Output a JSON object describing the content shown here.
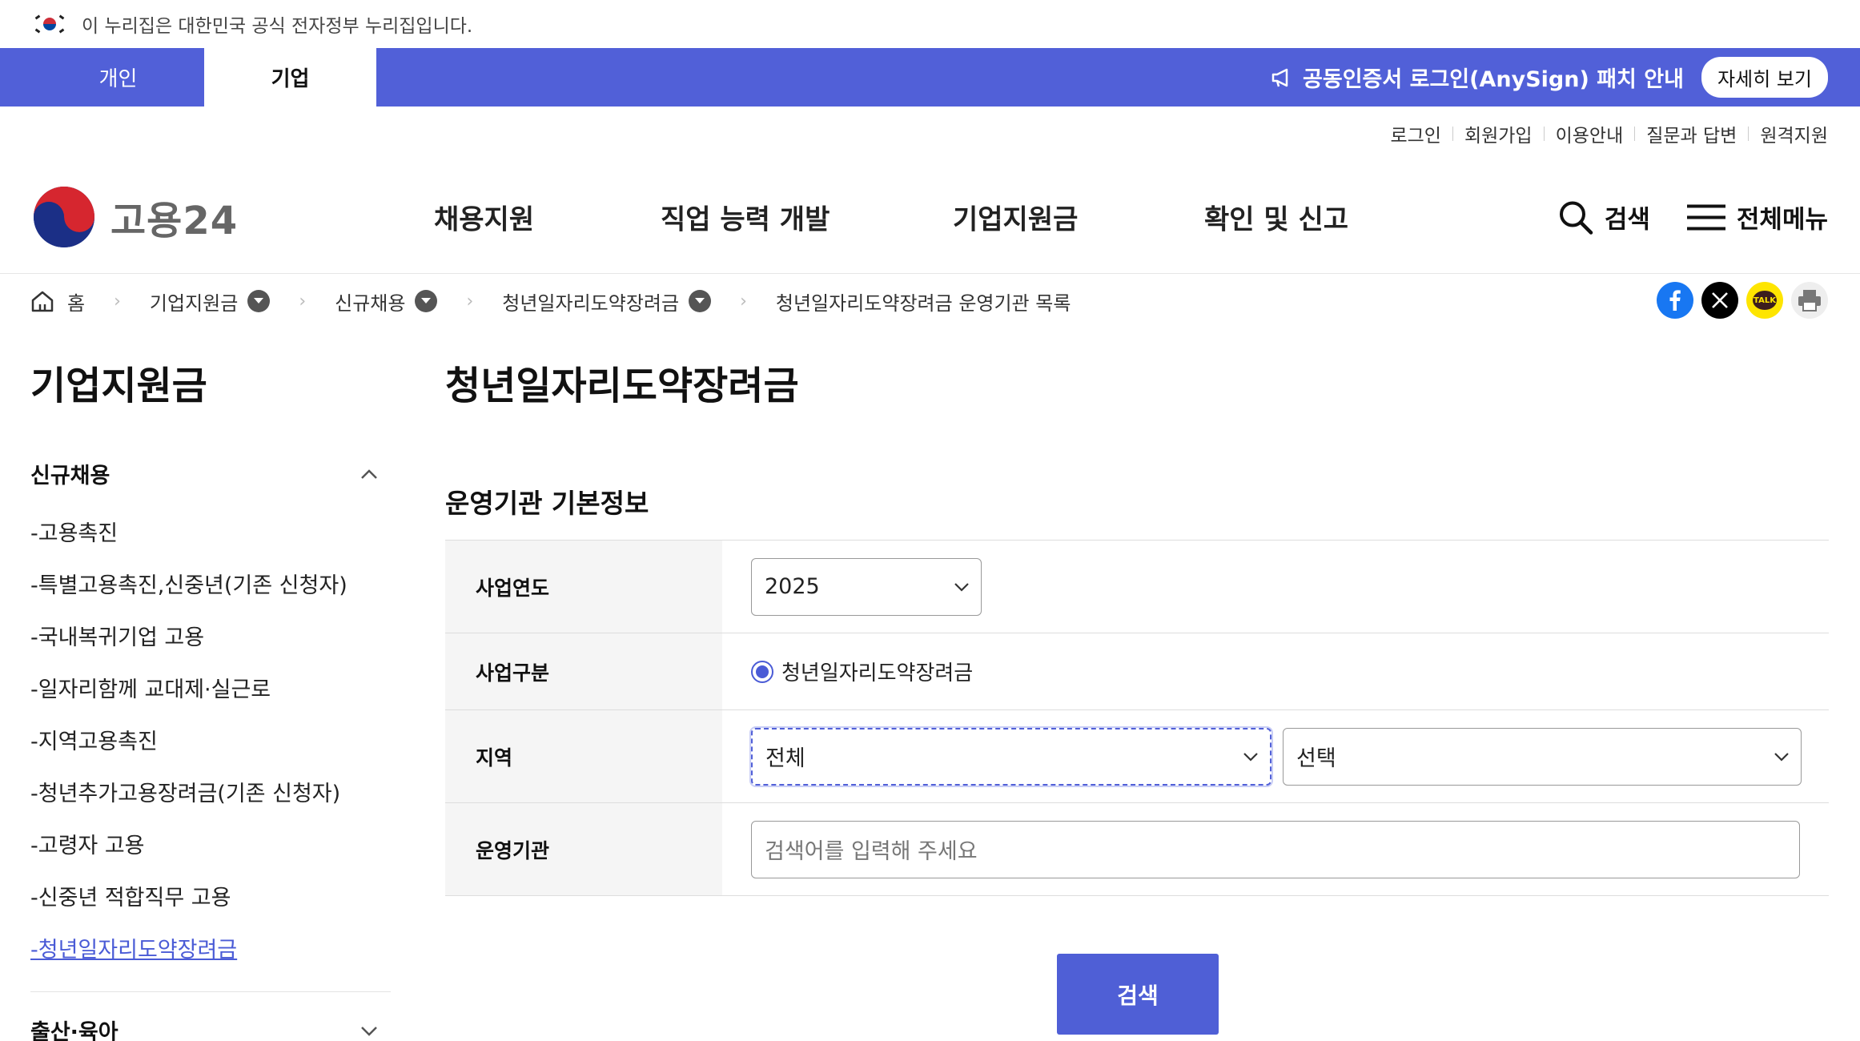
{
  "gov_banner": {
    "text": "이 누리집은 대한민국 공식 전자정부 누리집입니다."
  },
  "user_tabs": [
    {
      "label": "개인"
    },
    {
      "label": "기업"
    }
  ],
  "notice": {
    "text": "공동인증서 로그인(AnySign) 패치 안내",
    "button": "자세히 보기"
  },
  "util_links": [
    "로그인",
    "회원가입",
    "이용안내",
    "질문과 답변",
    "원격지원"
  ],
  "logo": {
    "text": "고용24"
  },
  "gnb": [
    "채용지원",
    "직업 능력 개발",
    "기업지원금",
    "확인 및 신고"
  ],
  "header_actions": {
    "search": "검색",
    "menu": "전체메뉴"
  },
  "breadcrumb": {
    "home": "홈",
    "items": [
      "기업지원금",
      "신규채용",
      "청년일자리도약장려금",
      "청년일자리도약장려금 운영기관 목록"
    ]
  },
  "share": {
    "kakao": "TALK"
  },
  "lnb": {
    "title": "기업지원금",
    "group": "신규채용",
    "items": [
      "-고용촉진",
      "-특별고용촉진,신중년(기존 신청자)",
      "-국내복귀기업 고용",
      "-일자리함께 교대제·실근로",
      "-지역고용촉진",
      "-청년추가고용장려금(기존 신청자)",
      "-고령자 고용",
      "-신중년 적합직무 고용",
      "-청년일자리도약장려금"
    ],
    "group2": "출산·육아"
  },
  "main": {
    "title": "청년일자리도약장려금",
    "section": "운영기관 기본정보",
    "form": {
      "year_label": "사업연도",
      "year_value": "2025",
      "type_label": "사업구분",
      "type_value": "청년일자리도약장려금",
      "region_label": "지역",
      "region_value1": "전체",
      "region_value2": "선택",
      "org_label": "운영기관",
      "org_placeholder": "검색어를 입력해 주세요"
    },
    "search_button": "검색"
  },
  "colors": {
    "brand": "#5160d8",
    "active_link": "#4a5bd6"
  }
}
